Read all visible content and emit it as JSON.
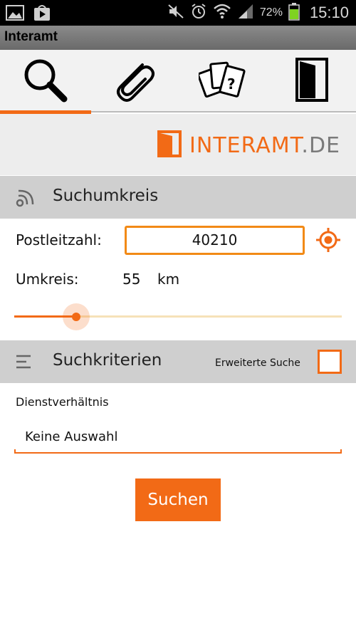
{
  "status_bar": {
    "battery": "72%",
    "time": "15:10"
  },
  "app": {
    "title": "Interamt"
  },
  "tabs": [
    {
      "icon": "search-icon",
      "active": true
    },
    {
      "icon": "paperclip-icon",
      "active": false
    },
    {
      "icon": "cards-question-icon",
      "active": false
    },
    {
      "icon": "exit-door-icon",
      "active": false
    }
  ],
  "logo": {
    "main": "INTERAMT",
    "tld": ".DE"
  },
  "suchumkreis": {
    "title": "Suchumkreis",
    "postleitzahl_label": "Postleitzahl:",
    "postleitzahl_value": "40210",
    "umkreis_label": "Umkreis:",
    "umkreis_value": "55",
    "umkreis_unit": "km",
    "slider_fraction": 0.19
  },
  "suchkriterien": {
    "title": "Suchkriterien",
    "erweiterte_label": "Erweiterte Suche",
    "erweiterte_checked": false,
    "dienstverhaeltnis_label": "Dienstverhältnis",
    "dienstverhaeltnis_value": "Keine Auswahl"
  },
  "actions": {
    "search_label": "Suchen"
  },
  "colors": {
    "accent": "#f26a16",
    "header_bg": "#cfcfcf"
  }
}
